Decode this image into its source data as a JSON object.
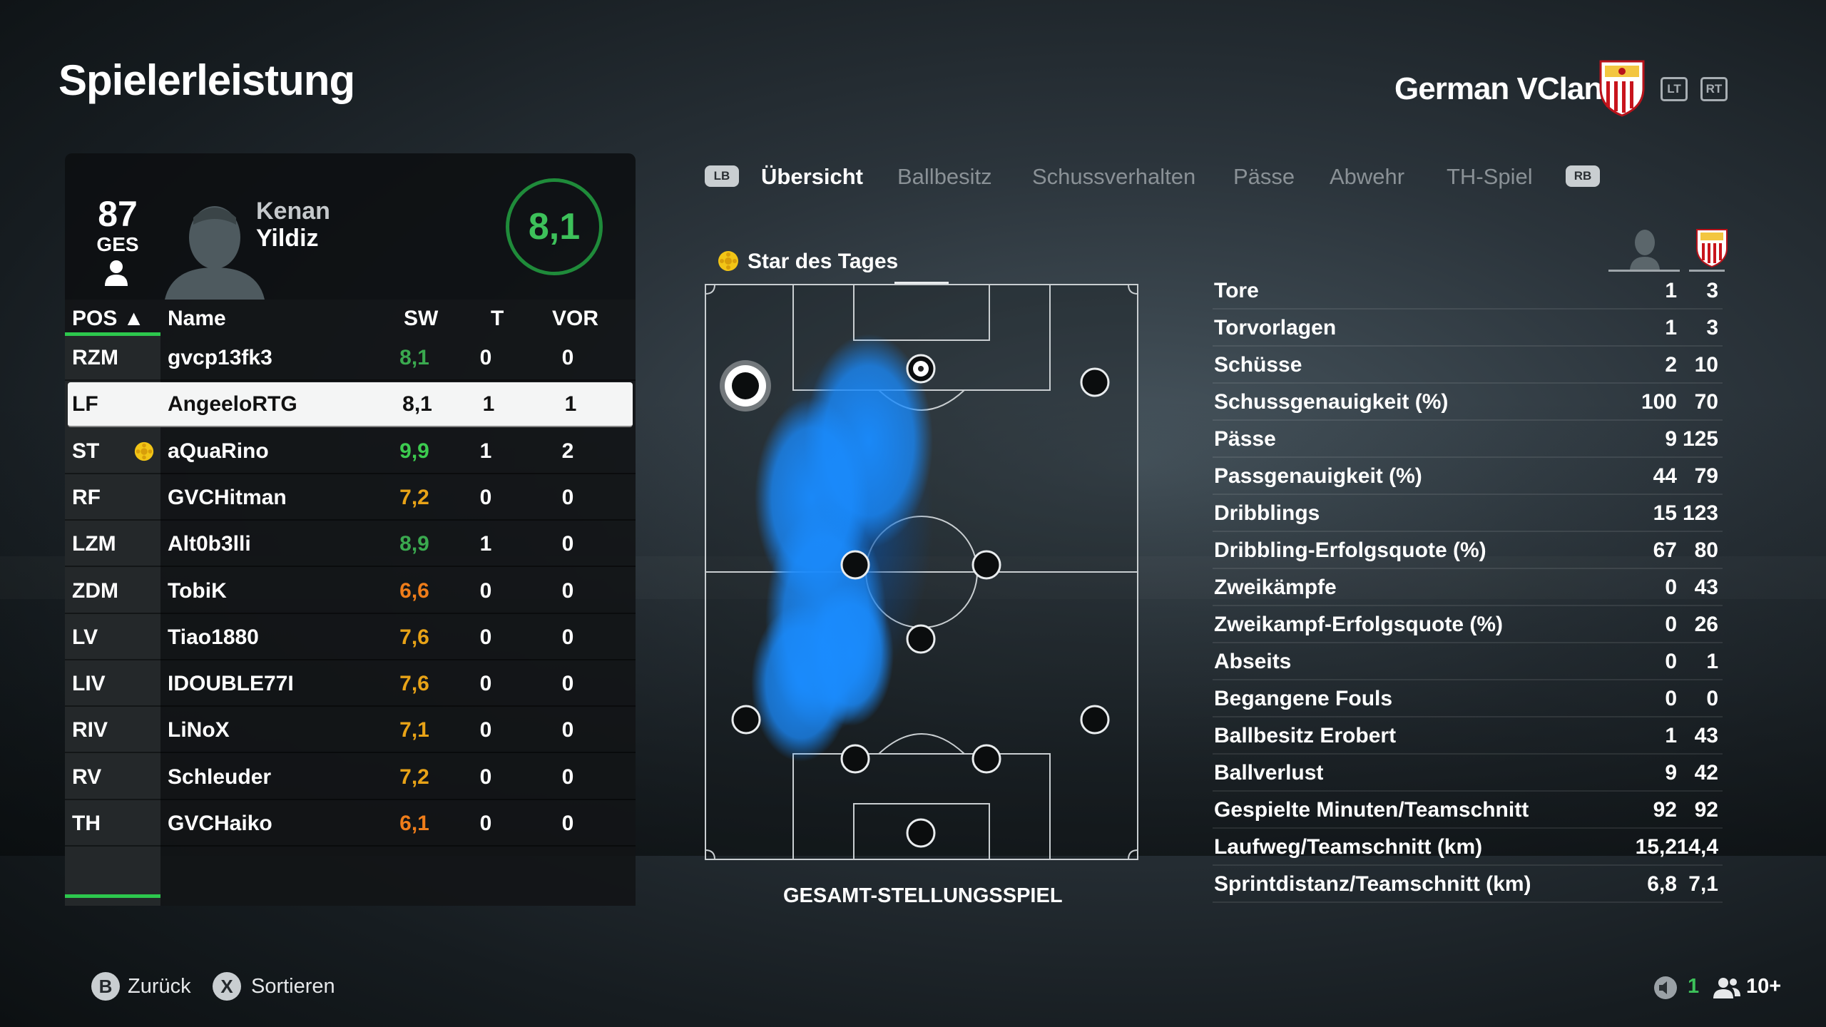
{
  "page": {
    "title": "Spielerleistung"
  },
  "header": {
    "club_name": "German VClan",
    "lt_label": "LT",
    "rt_label": "RT"
  },
  "player_card": {
    "rating": "87",
    "rating_label": "GES",
    "first_name": "Kenan",
    "last_name": "Yildiz",
    "match_score": "8,1"
  },
  "table": {
    "headers": {
      "pos": "POS ▲",
      "name": "Name",
      "sw": "SW",
      "t": "T",
      "vor": "VOR"
    },
    "rows": [
      {
        "pos": "RZM",
        "name": "gvcp13fk3",
        "sw": "8,1",
        "t": "0",
        "vor": "0",
        "color": "#3aa94f"
      },
      {
        "pos": "LF",
        "name": "AngeeloRTG",
        "sw": "8,1",
        "t": "1",
        "vor": "1",
        "color": "#111111"
      },
      {
        "pos": "ST",
        "name": "aQuaRino",
        "sw": "9,9",
        "t": "1",
        "vor": "2",
        "color": "#3ccb4f",
        "star": true
      },
      {
        "pos": "RF",
        "name": "GVCHitman",
        "sw": "7,2",
        "t": "0",
        "vor": "0",
        "color": "#e8a317"
      },
      {
        "pos": "LZM",
        "name": "Alt0b3lli",
        "sw": "8,9",
        "t": "1",
        "vor": "0",
        "color": "#3aa94f"
      },
      {
        "pos": "ZDM",
        "name": "TobiK",
        "sw": "6,6",
        "t": "0",
        "vor": "0",
        "color": "#ef7d1a"
      },
      {
        "pos": "LV",
        "name": "Tiao1880",
        "sw": "7,6",
        "t": "0",
        "vor": "0",
        "color": "#e8a317"
      },
      {
        "pos": "LIV",
        "name": "IDOUBLE77I",
        "sw": "7,6",
        "t": "0",
        "vor": "0",
        "color": "#e8a317"
      },
      {
        "pos": "RIV",
        "name": "LiNoX",
        "sw": "7,1",
        "t": "0",
        "vor": "0",
        "color": "#e8a317"
      },
      {
        "pos": "RV",
        "name": "Schleuder",
        "sw": "7,2",
        "t": "0",
        "vor": "0",
        "color": "#e8a317"
      },
      {
        "pos": "TH",
        "name": "GVCHaiko",
        "sw": "6,1",
        "t": "0",
        "vor": "0",
        "color": "#ef7d1a"
      }
    ]
  },
  "tabs": {
    "lb_label": "LB",
    "rb_label": "RB",
    "items": [
      "Übersicht",
      "Ballbesitz",
      "Schussverhalten",
      "Pässe",
      "Abwehr",
      "TH-Spiel"
    ],
    "active": "Übersicht"
  },
  "pitch": {
    "title": "Star des Tages",
    "caption": "GESAMT-STELLUNGSSPIEL"
  },
  "stats": [
    {
      "label": "Tore",
      "player": "1",
      "team": "3"
    },
    {
      "label": "Torvorlagen",
      "player": "1",
      "team": "3"
    },
    {
      "label": "Schüsse",
      "player": "2",
      "team": "10"
    },
    {
      "label": "Schussgenauigkeit (%)",
      "player": "100",
      "team": "70"
    },
    {
      "label": "Pässe",
      "player": "9",
      "team": "125"
    },
    {
      "label": "Passgenauigkeit (%)",
      "player": "44",
      "team": "79"
    },
    {
      "label": "Dribblings",
      "player": "15",
      "team": "123"
    },
    {
      "label": "Dribbling-Erfolgsquote (%)",
      "player": "67",
      "team": "80"
    },
    {
      "label": "Zweikämpfe",
      "player": "0",
      "team": "43"
    },
    {
      "label": "Zweikampf-Erfolgsquote (%)",
      "player": "0",
      "team": "26"
    },
    {
      "label": "Abseits",
      "player": "0",
      "team": "1"
    },
    {
      "label": "Begangene Fouls",
      "player": "0",
      "team": "0"
    },
    {
      "label": "Ballbesitz Erobert",
      "player": "1",
      "team": "43"
    },
    {
      "label": "Ballverlust",
      "player": "9",
      "team": "42"
    },
    {
      "label": "Gespielte Minuten/Teamschnitt",
      "player": "92",
      "team": "92"
    },
    {
      "label": "Laufweg/Teamschnitt (km)",
      "player": "15,2",
      "team": "14,4"
    },
    {
      "label": "Sprintdistanz/Teamschnitt (km)",
      "player": "6,8",
      "team": "7,1"
    }
  ],
  "footer": {
    "back_button": "B",
    "back_label": "Zurück",
    "sort_button": "X",
    "sort_label": "Sortieren",
    "mic_count": "1",
    "party_count": "10+"
  },
  "colors": {
    "accent_green": "#2dc84d",
    "heatmap_blue": "#1a8cff"
  }
}
